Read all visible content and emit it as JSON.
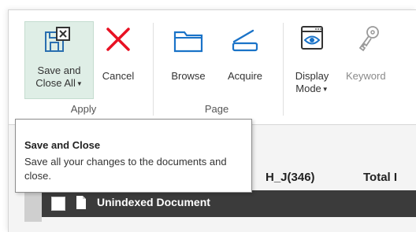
{
  "colors": {
    "cancel_red": "#e81123",
    "accent_blue": "#1a73c8",
    "active_bg": "#dfeee6",
    "dark_row_bg": "#3b3b3b"
  },
  "ribbon": {
    "apply_group": {
      "label": "Apply",
      "save_close": {
        "line1": "Save and",
        "line2": "Close All",
        "icon": "save-close-icon"
      },
      "cancel": {
        "label": "Cancel",
        "icon": "cancel-x-icon"
      }
    },
    "page_group": {
      "label": "Page",
      "browse": {
        "label": "Browse",
        "icon": "folder-icon"
      },
      "acquire": {
        "label": "Acquire",
        "icon": "scanner-icon"
      }
    },
    "display_mode": {
      "line1": "Display",
      "line2": "Mode",
      "icon": "display-eye-icon"
    },
    "keywords": {
      "label": "Keyword",
      "icon": "keys-icon"
    }
  },
  "tooltip": {
    "title": "Save and Close",
    "body": "Save all your changes to the documents and close."
  },
  "table": {
    "col_header_1": "H_J(346)",
    "col_header_2": "Total I",
    "row_label": "Unindexed Document"
  }
}
